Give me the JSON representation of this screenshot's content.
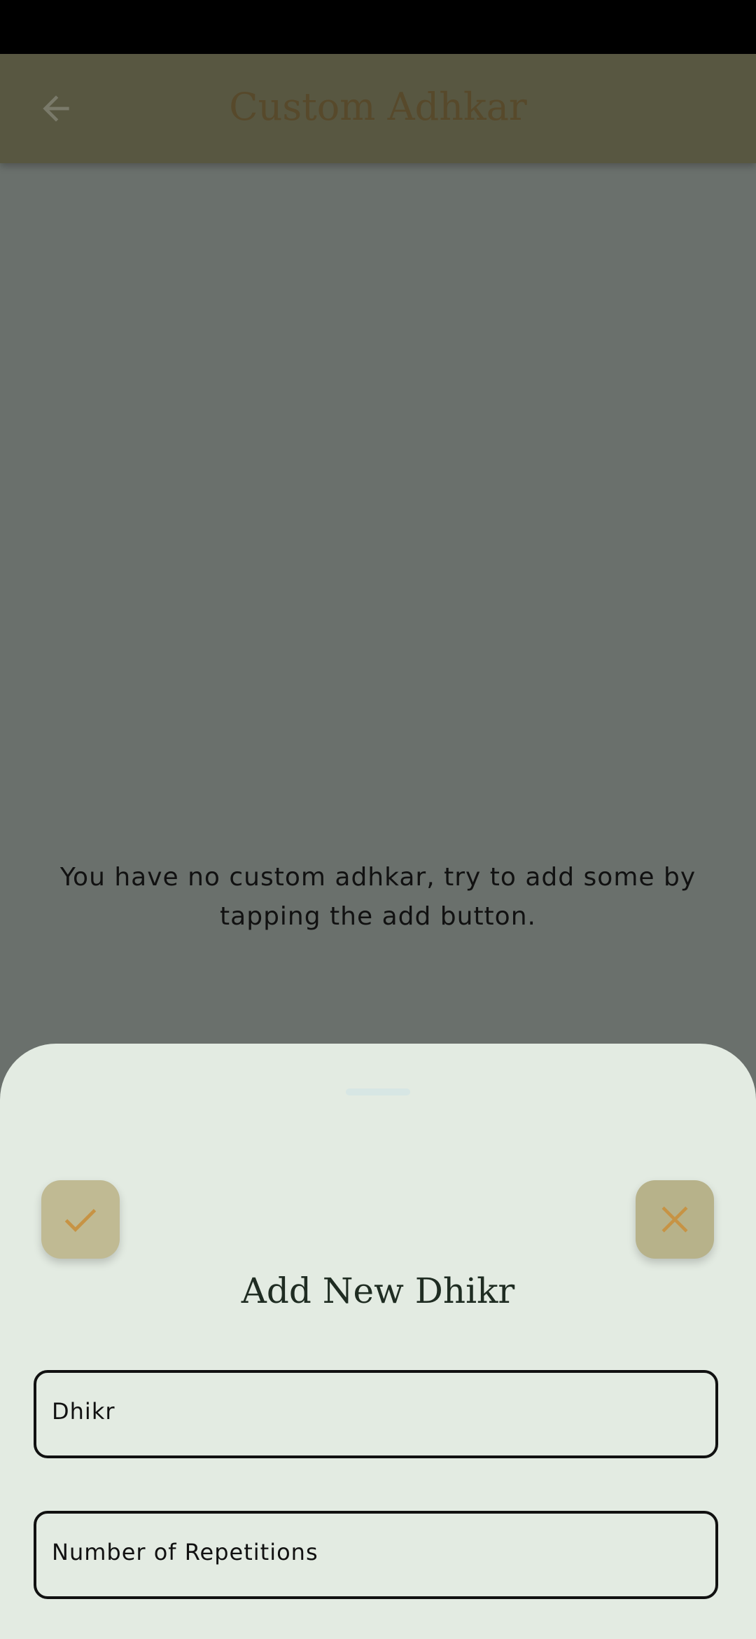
{
  "app_bar": {
    "title": "Custom Adhkar",
    "back_icon": "arrow-left-icon"
  },
  "empty_state": {
    "message": "You have no custom adhkar, try to add some by tapping the add button."
  },
  "sheet": {
    "title": "Add New Dhikr",
    "confirm_icon": "check-icon",
    "cancel_icon": "close-icon",
    "fields": {
      "dhikr_placeholder": "Dhikr",
      "repetitions_placeholder": "Number of Repetitions"
    }
  },
  "colors": {
    "scrim": "#6a706c",
    "app_bar": "#585741",
    "title_text": "#57492b",
    "sheet_bg": "#e3ebe2",
    "button_bg": "#c0ba93",
    "icon_accent": "#c79344"
  }
}
